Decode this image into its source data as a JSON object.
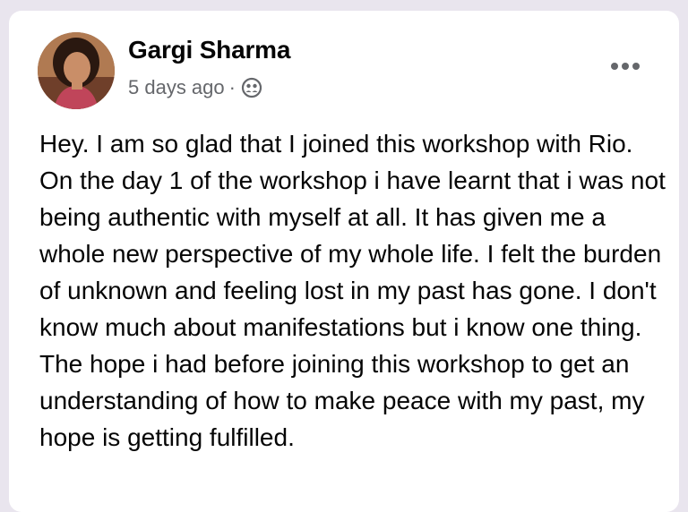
{
  "post": {
    "author": "Gargi Sharma",
    "timestamp": "5 days ago",
    "separator": "·",
    "audience_icon": "friends-icon",
    "more_icon": "more-horizontal-icon",
    "text": "Hey. I am so glad that I joined this workshop with Rio. On the day 1 of the workshop i have learnt that i was not being authentic with myself at all. It has given me a whole new perspective of my whole life. I felt the burden of unknown and feeling lost in my past has gone. I don't know much about manifestations but i know one thing. The hope i had before joining this workshop to get an understanding of how to make peace with my past, my hope is getting fulfilled."
  },
  "colors": {
    "background": "#e9e5ee",
    "card": "#ffffff",
    "primary_text": "#050505",
    "secondary_text": "#65676b"
  }
}
